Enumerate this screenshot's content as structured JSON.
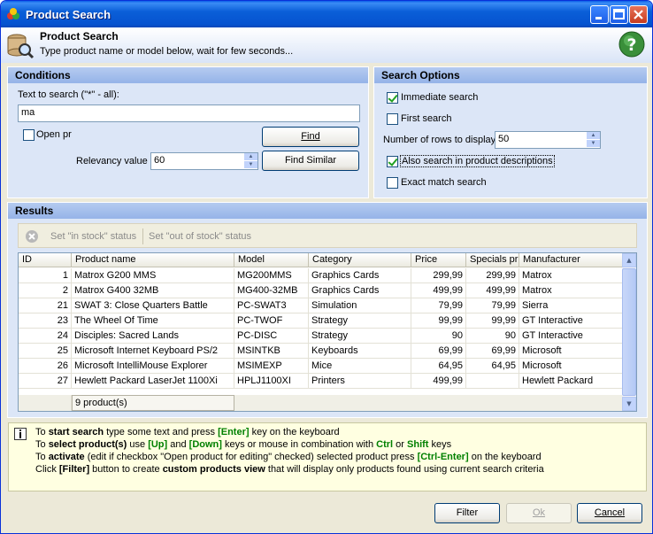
{
  "window": {
    "title": "Product Search"
  },
  "header": {
    "title": "Product Search",
    "subtitle": "Type product name or model below, wait for few seconds..."
  },
  "conditions": {
    "heading": "Conditions",
    "search_label": "Text to search (\"*\" - all):",
    "search_value": "ma",
    "open_checkbox_label": "Open pr",
    "find_button": "Find",
    "relevancy_label": "Relevancy value",
    "relevancy_value": "60",
    "find_similar_button": "Find Similar"
  },
  "search_options": {
    "heading": "Search Options",
    "immediate_search": "Immediate search",
    "first_search": "First search",
    "rows_label": "Number of rows to display",
    "rows_value": "50",
    "also_search": "Also search in product descriptions",
    "exact_match": "Exact match search"
  },
  "results": {
    "heading": "Results",
    "toolbar": {
      "in_stock": "Set \"in stock\" status",
      "out_of_stock": "Set \"out of stock\" status"
    },
    "columns": [
      "ID",
      "Product name",
      "Model",
      "Category",
      "Price",
      "Specials pri",
      "Manufacturer"
    ],
    "rows": [
      [
        "1",
        "Matrox G200 MMS",
        "MG200MMS",
        "Graphics Cards",
        "299,99",
        "299,99",
        "Matrox"
      ],
      [
        "2",
        "Matrox G400 32MB",
        "MG400-32MB",
        "Graphics Cards",
        "499,99",
        "499,99",
        "Matrox"
      ],
      [
        "21",
        "SWAT 3: Close Quarters Battle",
        "PC-SWAT3",
        "Simulation",
        "79,99",
        "79,99",
        "Sierra"
      ],
      [
        "23",
        "The Wheel Of Time",
        "PC-TWOF",
        "Strategy",
        "99,99",
        "99,99",
        "GT Interactive"
      ],
      [
        "24",
        "Disciples: Sacred Lands",
        "PC-DISC",
        "Strategy",
        "90",
        "90",
        "GT Interactive"
      ],
      [
        "25",
        "Microsoft Internet Keyboard PS/2",
        "MSINTKB",
        "Keyboards",
        "69,99",
        "69,99",
        "Microsoft"
      ],
      [
        "26",
        "Microsoft IntelliMouse Explorer",
        "MSIMEXP",
        "Mice",
        "64,95",
        "64,95",
        "Microsoft"
      ],
      [
        "27",
        "Hewlett Packard LaserJet 1100Xi",
        "HPLJ1100XI",
        "Printers",
        "499,99",
        "",
        "Hewlett Packard"
      ]
    ],
    "footer_count": "9 product(s)"
  },
  "info": {
    "l1a": "To ",
    "l1b": "start search",
    "l1c": " type some text and press ",
    "l1d": "[Enter]",
    "l1e": " key on the keyboard",
    "l2a": "To ",
    "l2b": "select product(s)",
    "l2c": " use ",
    "l2d": "[Up]",
    "l2e": " and ",
    "l2f": "[Down]",
    "l2g": " keys or mouse in combination with ",
    "l2h": "Ctrl",
    "l2i": " or ",
    "l2j": "Shift",
    "l2k": " keys",
    "l3a": "To ",
    "l3b": "activate",
    "l3c": " (edit if checkbox \"Open product for editing\" checked) selected product press ",
    "l3d": "[Ctrl-Enter]",
    "l3e": " on the keyboard",
    "l4a": "Click ",
    "l4b": "[Filter]",
    "l4c": " button to create ",
    "l4d": "custom products view",
    "l4e": " that will display only products found using current search criteria"
  },
  "buttons": {
    "filter": "Filter",
    "ok": "Ok",
    "cancel": "Cancel"
  }
}
